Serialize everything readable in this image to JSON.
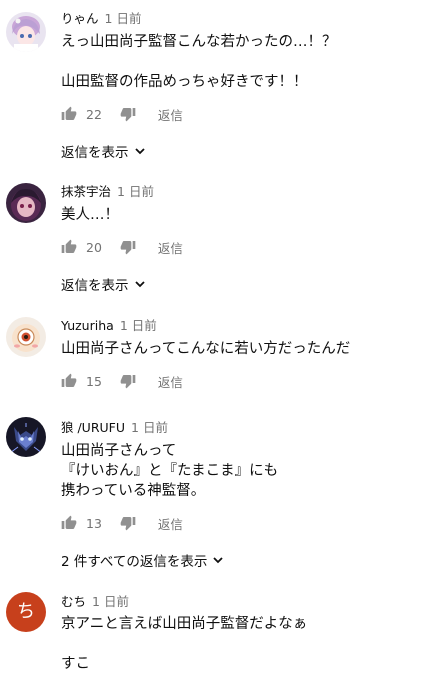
{
  "comments": [
    {
      "author": "りゃん",
      "time": "1 日前",
      "lines": [
        "えっ山田尚子監督こんな若かったの…！？",
        "",
        "山田監督の作品めっちゃ好きです！！"
      ],
      "likes": "22",
      "reply_label": "返信",
      "replies_label": "返信を表示",
      "avatar_icon": "anime-girl-avatar-icon"
    },
    {
      "author": "抹茶宇治",
      "time": "1 日前",
      "lines": [
        "美人…！"
      ],
      "likes": "20",
      "reply_label": "返信",
      "replies_label": "返信を表示",
      "avatar_icon": "anime-character-avatar-icon"
    },
    {
      "author": "Yuzuriha",
      "time": "1 日前",
      "lines": [
        "山田尚子さんってこんなに若い方だったんだ"
      ],
      "likes": "15",
      "reply_label": "返信",
      "avatar_icon": "eye-character-avatar-icon"
    },
    {
      "author": "狼 /URUFU",
      "time": "1 日前",
      "lines": [
        "山田尚子さんって",
        "『けいおん』と『たまこま』にも",
        "携わっている神監督。"
      ],
      "likes": "13",
      "reply_label": "返信",
      "replies_label": "2 件すべての返信を表示",
      "avatar_icon": "wolf-avatar-icon"
    },
    {
      "author": "むち",
      "time": "1 日前",
      "lines": [
        "京アニと言えば山田尚子監督だよなぁ",
        "",
        "すこ"
      ],
      "avatar_letter": "ち",
      "avatar_color": "#c7401c"
    }
  ],
  "icons": {
    "like": "thumbs-up-icon",
    "dislike": "thumbs-down-icon",
    "chevron": "chevron-down-icon"
  },
  "colors": {
    "secondary_text": "#737373",
    "icon": "#909090"
  }
}
